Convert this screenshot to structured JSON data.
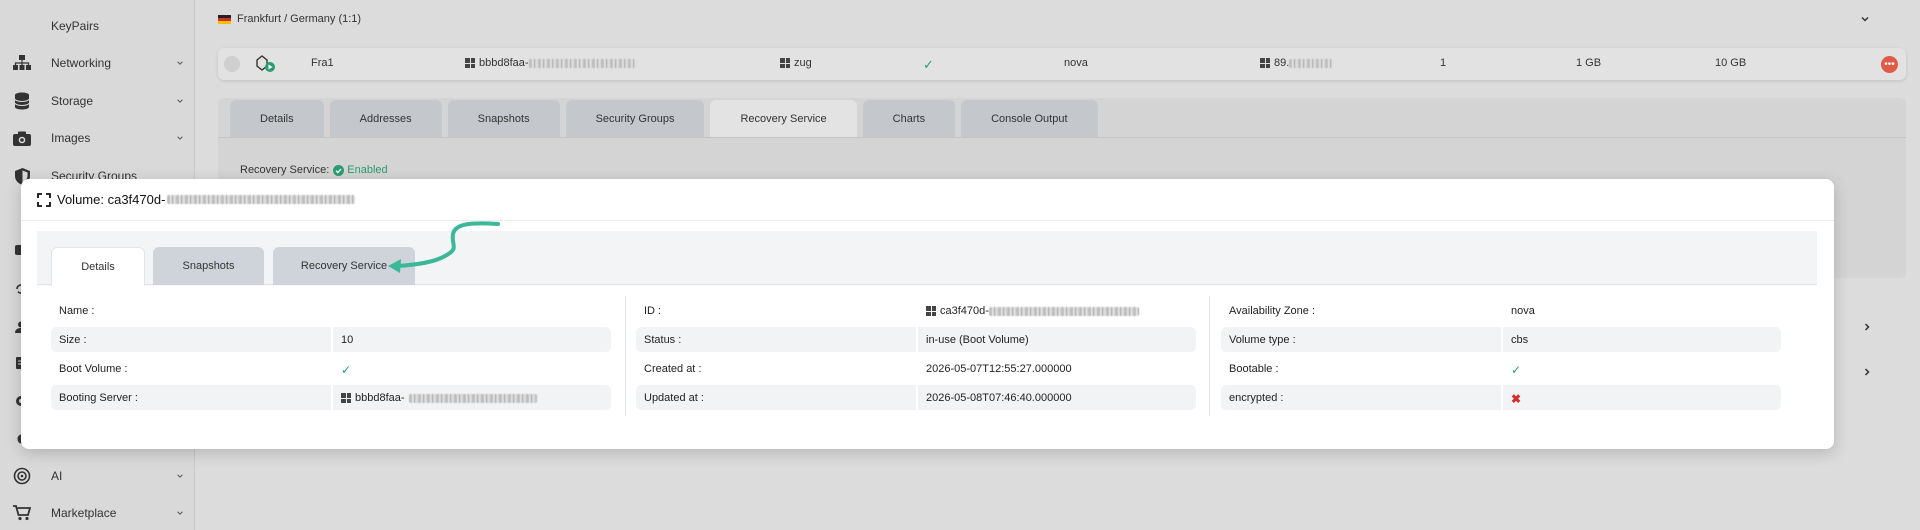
{
  "sidebar": {
    "items": [
      {
        "label": "KeyPairs",
        "icon": "key-icon"
      },
      {
        "label": "Networking",
        "icon": "network-icon"
      },
      {
        "label": "Storage",
        "icon": "storage-icon"
      },
      {
        "label": "Images",
        "icon": "camera-icon"
      },
      {
        "label": "Security Groups",
        "icon": "shield-icon"
      },
      {
        "label": "AI",
        "icon": "ai-icon"
      },
      {
        "label": "Marketplace",
        "icon": "cart-icon"
      }
    ]
  },
  "region": {
    "label": "Frankfurt / Germany (1:1)"
  },
  "server": {
    "name": "Fra1",
    "id": "bbbd8faa-",
    "user": "zug",
    "availability": "nova",
    "ip": "89.",
    "count": "1",
    "ram": "1 GB",
    "disk": "10 GB"
  },
  "bg_tabs": [
    "Details",
    "Addresses",
    "Snapshots",
    "Security Groups",
    "Recovery Service",
    "Charts",
    "Console Output"
  ],
  "recovery": {
    "label": "Recovery Service:",
    "status": "Enabled"
  },
  "modal": {
    "title": "Volume: ca3f470d-",
    "tabs": [
      "Details",
      "Snapshots",
      "Recovery Service"
    ],
    "col1": [
      {
        "k": "Name :",
        "v": ""
      },
      {
        "k": "Size :",
        "v": "10"
      },
      {
        "k": "Boot Volume :",
        "v": ""
      },
      {
        "k": "Booting Server :",
        "v": "bbbd8faa-"
      }
    ],
    "col2": [
      {
        "k": "ID :",
        "v": "ca3f470d-"
      },
      {
        "k": "Status :",
        "v": "in-use (Boot Volume)"
      },
      {
        "k": "Created at :",
        "v": "2026-05-07T12:55:27.000000"
      },
      {
        "k": "Updated at :",
        "v": "2026-05-08T07:46:40.000000"
      }
    ],
    "col3": [
      {
        "k": "Availability Zone :",
        "v": "nova"
      },
      {
        "k": "Volume type :",
        "v": "cbs"
      },
      {
        "k": "Bootable :",
        "v": ""
      },
      {
        "k": "encrypted :",
        "v": ""
      }
    ]
  },
  "colors": {
    "accent_green": "#2a9d6f",
    "danger_red": "#d0312d",
    "arrow_teal": "#3bb79a"
  }
}
